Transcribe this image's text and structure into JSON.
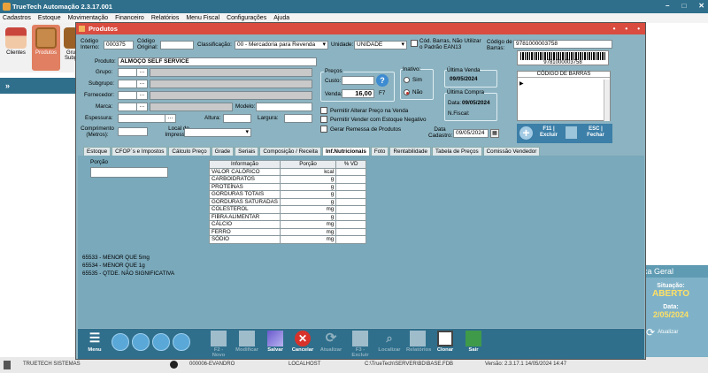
{
  "app": {
    "title": "TrueTech Automação 2.3.17.001"
  },
  "menu": [
    "Cadastros",
    "Estoque",
    "Movimentação",
    "Financeiro",
    "Relatórios",
    "Menu Fiscal",
    "Configurações",
    "Ajuda"
  ],
  "toolbar": {
    "clientes": "Clientes",
    "produtos": "Produtos",
    "grupos": "Gru Subg"
  },
  "leftbar": {
    "glyph": "»"
  },
  "dialog": {
    "title": "Produtos",
    "codigo_interno_label": "Código Interno:",
    "codigo_interno": "000375",
    "codigo_original_label": "Código Original:",
    "codigo_original": "",
    "classificacao_label": "Classificação:",
    "classificacao": "00 - Mercadoria para Revenda",
    "unidade_label": "Unidade:",
    "unidade": "UNIDADE",
    "cod_barras_nao_utilizar": "Cód. Barras, Não Utilizar o Padrão EAN13",
    "codigo_barras_label": "Código de Barras:",
    "codigo_barras": "9781000003758",
    "barcode_text": "9781000003758",
    "codigo_barras_list_header": "CÓDIGO DE BARRAS",
    "f11_label": "F11 | Excluir",
    "esc_label": "ESC | Fechar",
    "produto_label": "Produto:",
    "produto": "ALMOÇO SELF SERVICE",
    "grupo_label": "Grupo:",
    "subgrupo_label": "Subgrupo:",
    "fornecedor_label": "Fornecedor:",
    "marca_label": "Marca:",
    "modelo_label": "Modelo:",
    "espessura_label": "Espessura:",
    "altura_label": "Altura:",
    "largura_label": "Largura:",
    "comprimento_label": "Comprimento (Metros):",
    "local_impressao_label": "Local de Impressão:",
    "dots": "...",
    "precos_label": "Preços",
    "custo_label": "Custo:",
    "custo": "",
    "venda_label": "Venda:",
    "venda": "16,00",
    "f7": "F7",
    "help_glyph": "?",
    "inativo_label": "Inativo:",
    "sim": "Sim",
    "nao": "Não",
    "ultima_venda_label": "Última Venda",
    "ultima_venda": "09/05/2024",
    "ultima_compra_label": "Última Compra",
    "data_label": "Data:",
    "ultima_compra_data": "09/05/2024",
    "nfiscal_label": "N.Fiscal:",
    "permitir_alterar_preco": "Permitir Alterar Preço na Venda",
    "permitir_vender_estoque": "Permitir Vender com Estoque Negativo",
    "gerar_remessa": "Gerar Remessa de Produtos",
    "data_cadastro_label": "Data Cadastro:",
    "data_cadastro": "09/05/2024"
  },
  "tabs": [
    "Estoque",
    "CFOP´s e Impostos",
    "Cálculo Preço",
    "Grade",
    "Seriais",
    "Composição / Receita",
    "Inf.Nutricionais",
    "Foto",
    "Rentabilidade",
    "Tabela de Preços",
    "Comissão Vendedor"
  ],
  "active_tab": 6,
  "nutri": {
    "porcao_label": "Porção",
    "porcao": "",
    "headers": [
      "Informação",
      "Porção",
      "% VD"
    ],
    "rows": [
      {
        "info": "VALOR CALÓRICO",
        "unit": "kcal"
      },
      {
        "info": "CARBOIDRATOS",
        "unit": "g"
      },
      {
        "info": "PROTEÍNAS",
        "unit": "g"
      },
      {
        "info": "GORDURAS TOTAIS",
        "unit": "g"
      },
      {
        "info": "GORDURAS SATURADAS",
        "unit": "g"
      },
      {
        "info": "COLESTEROL",
        "unit": "mg"
      },
      {
        "info": "FIBRA ALIMENTAR",
        "unit": "g"
      },
      {
        "info": "CÁLCIO",
        "unit": "mg"
      },
      {
        "info": "FERRO",
        "unit": "mg"
      },
      {
        "info": "SÓDIO",
        "unit": "mg"
      }
    ],
    "notes": [
      "65533 - MENOR QUE 5mg",
      "65534 - MENOR QUE 1g",
      "65535 - QTDE. NÃO SIGNIFICATIVA"
    ]
  },
  "bottom": {
    "menu": "Menu",
    "novo": "F2 - Novo",
    "modificar": "Modificar",
    "salvar": "Salvar",
    "cancelar": "Cancelar",
    "atualizar": "Atualizar",
    "excluir": "F3 - Excluir",
    "localizar": "Localizar",
    "relatorios": "Relatórios",
    "clonar": "Clonar",
    "sair": "Sair"
  },
  "caixa": {
    "header": "aixa Geral",
    "situacao_label": "Situação:",
    "situacao": "ABERTO",
    "data_label": "Data:",
    "data": "2/05/2024",
    "atualizar": "Atualizar"
  },
  "status": {
    "system": "TRUETECH SISTEMAS",
    "user": "000006-EVANDRO",
    "host": "LOCALHOST",
    "db": "C:\\TrueTech\\SERVER\\BD\\BASE.FDB",
    "version": "Versão: 2.3.17.1   14/05/2024 14:47"
  },
  "colors": {
    "titlebar": "#2f6f8c",
    "dialog_title": "#d94c3f",
    "dialog_bg": "#8cb3c1"
  }
}
